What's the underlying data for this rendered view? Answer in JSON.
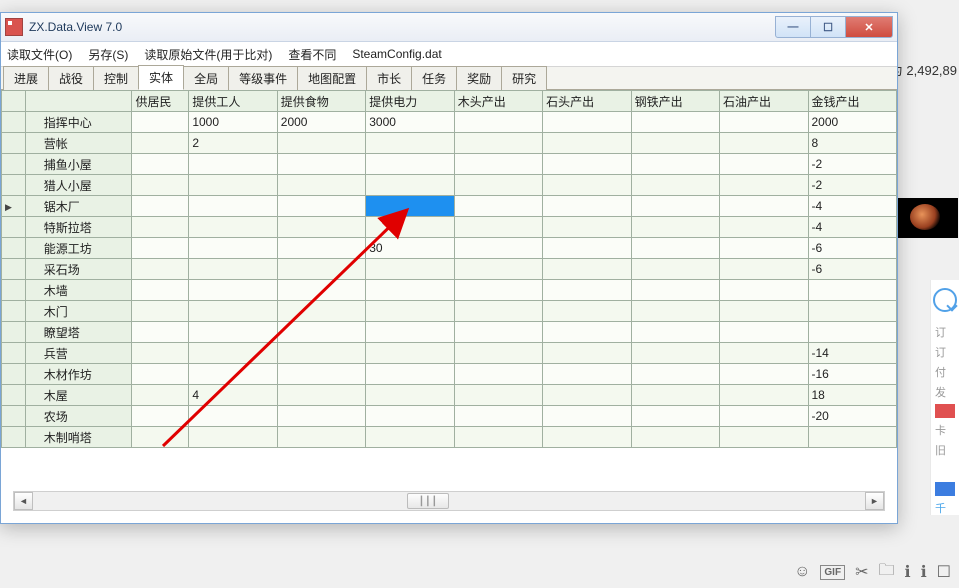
{
  "window": {
    "title": "ZX.Data.View 7.0"
  },
  "menu": {
    "open": "读取文件(O)",
    "save": "另存(S)",
    "open_orig": "读取原始文件(用于比对)",
    "diff": "查看不同",
    "filename": "SteamConfig.dat"
  },
  "tabs": {
    "progress": "进展",
    "battle": "战役",
    "control": "控制",
    "entity": "实体",
    "global": "全局",
    "rank_event": "等级事件",
    "map_config": "地图配置",
    "mayor": "市长",
    "task": "任务",
    "reward": "奖励",
    "research": "研究",
    "active": "entity"
  },
  "columns": {
    "c1": "供居民",
    "c2": "提供工人",
    "c3": "提供食物",
    "c4": "提供电力",
    "c5": "木头产出",
    "c6": "石头产出",
    "c7": "钢铁产出",
    "c8": "石油产出",
    "c9": "金钱产出"
  },
  "rows": {
    "r0": {
      "name": "指挥中心",
      "c2": "1000",
      "c3": "2000",
      "c4": "3000",
      "c9": "2000"
    },
    "r1": {
      "name": "营帐",
      "c2": "2",
      "c9": "8"
    },
    "r2": {
      "name": "捕鱼小屋",
      "c9": "-2"
    },
    "r3": {
      "name": "猎人小屋",
      "c9": "-2"
    },
    "r4": {
      "name": "锯木厂",
      "c9": "-4"
    },
    "r5": {
      "name": "特斯拉塔",
      "c9": "-4"
    },
    "r6": {
      "name": "能源工坊",
      "c4": "30",
      "c9": "-6"
    },
    "r7": {
      "name": "采石场",
      "c9": "-6"
    },
    "r8": {
      "name": "木墙"
    },
    "r9": {
      "name": "木门"
    },
    "r10": {
      "name": "瞭望塔"
    },
    "r11": {
      "name": "兵营",
      "c9": "-14"
    },
    "r12": {
      "name": "木材作坊",
      "c9": "-16"
    },
    "r13": {
      "name": "木屋",
      "c2": "4",
      "c9": "18"
    },
    "r14": {
      "name": "农场",
      "c9": "-20"
    },
    "r15": {
      "name": "木制哨塔"
    }
  },
  "bg_text": "为 2,492,89",
  "selected": {
    "row": 4,
    "col": "c4"
  }
}
